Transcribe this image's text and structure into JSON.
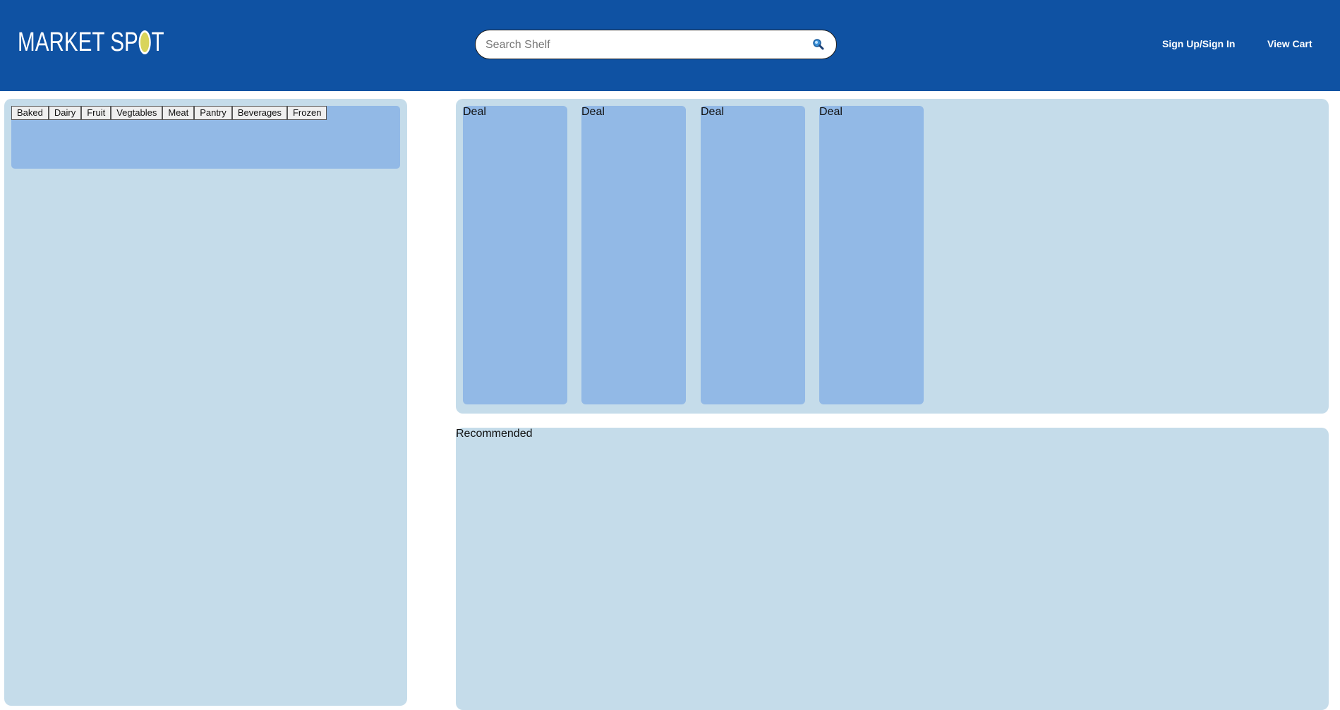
{
  "header": {
    "logo_text_left": "MARKET SP",
    "logo_text_right": "T",
    "search": {
      "placeholder": "Search Shelf",
      "value": ""
    },
    "nav": {
      "signin_label": "Sign Up/Sign In",
      "cart_label": "View Cart"
    }
  },
  "categories": [
    "Baked",
    "Dairy",
    "Fruit",
    "Vegtables",
    "Meat",
    "Pantry",
    "Beverages",
    "Frozen"
  ],
  "deals": [
    "Deal",
    "Deal",
    "Deal",
    "Deal"
  ],
  "recommended": {
    "label": "Recommended"
  },
  "colors": {
    "header_bg": "#0f52a3",
    "panel_bg": "#c5dcea",
    "card_bg": "#92b9e6",
    "logo_o": "#d9d45a"
  },
  "icons": {
    "search": "magnifier-icon"
  }
}
